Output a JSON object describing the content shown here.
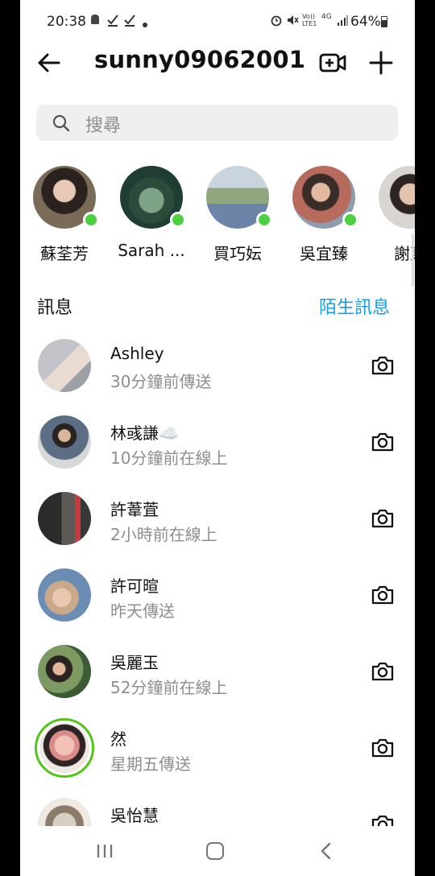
{
  "status_bar": {
    "time": "20:38",
    "battery": "64%",
    "left_icons": [
      "android-icon",
      "check-icon",
      "check-icon",
      "dot-icon"
    ],
    "right_icons": [
      "alarm-icon",
      "mute-icon",
      "volte-icon",
      "4g-icon",
      "signal-icon",
      "battery-icon"
    ],
    "volte": "Vo)) LTE1",
    "network": "4G"
  },
  "header": {
    "account": "sunny09062001",
    "icons": [
      "back-arrow-icon",
      "video-add-icon",
      "plus-icon"
    ]
  },
  "search": {
    "placeholder": "搜尋"
  },
  "stories": [
    {
      "name": "蘇荃芳",
      "online": true
    },
    {
      "name": "Sarah ...",
      "online": true
    },
    {
      "name": "買巧妘",
      "online": true
    },
    {
      "name": "吳宜臻",
      "online": true
    },
    {
      "name": "謝東",
      "online": false
    }
  ],
  "messages_section": {
    "title": "訊息",
    "requests": "陌生訊息"
  },
  "messages": [
    {
      "name": "Ashley",
      "status": "30分鐘前傳送"
    },
    {
      "name": "林彧謙☁️",
      "status": "10分鐘前在線上"
    },
    {
      "name": "許葦萓",
      "status": "2小時前在線上"
    },
    {
      "name": "許可暄",
      "status": "昨天傳送"
    },
    {
      "name": "吳麗玉",
      "status": "52分鐘前在線上"
    },
    {
      "name": "然",
      "status": "星期五傳送"
    },
    {
      "name": "吳怡慧",
      "status": ""
    }
  ],
  "colors": {
    "accent": "#1a9be8",
    "online": "#4cd042",
    "story_ring": "#52c41a"
  }
}
